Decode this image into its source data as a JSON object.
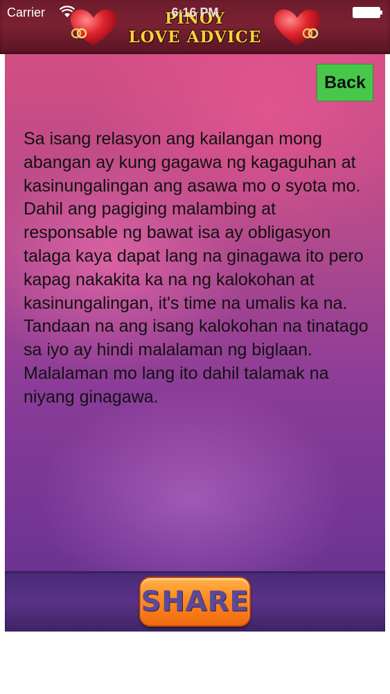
{
  "status_bar": {
    "carrier": "Carrier",
    "time": "6:16 PM"
  },
  "header": {
    "title_line1": "PINOY",
    "title_line2": "LOVE ADVICE",
    "left_icon": "heart-rings-icon",
    "right_icon": "heart-rings-icon"
  },
  "toolbar": {
    "back_label": "Back"
  },
  "advice": {
    "text": "Sa isang relasyon ang kailangan mong abangan ay kung gagawa ng kagaguhan at kasinungalingan ang asawa mo o syota mo. Dahil ang pagiging malambing at responsable ng bawat isa ay obligasyon talaga kaya dapat lang na ginagawa ito pero kapag nakakita ka na ng kalokohan at kasinungalingan, it's time na umalis ka na. Tandaan na ang isang kalokohan na tinatago sa iyo ay hindi malalaman ng biglaan. Malalaman mo lang ito dahil talamak na niyang ginagawa."
  },
  "footer": {
    "share_label": "SHARE"
  },
  "colors": {
    "back_button": "#48c84a",
    "share_button": "#ff8a1e",
    "title": "#f6d23a",
    "header_bg": "#7a2132"
  }
}
